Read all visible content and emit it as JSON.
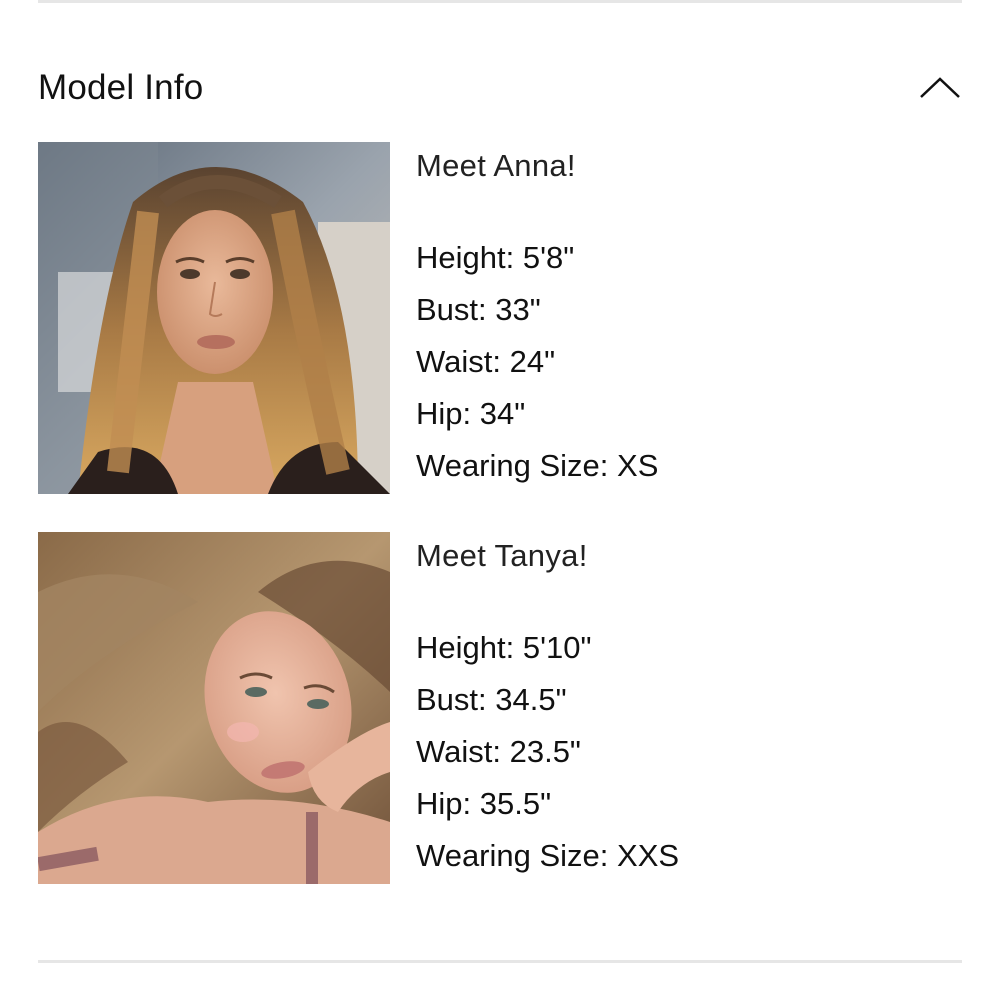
{
  "section": {
    "title": "Model Info",
    "icon": "chevron-up-icon"
  },
  "models": [
    {
      "greeting": "Meet Anna!",
      "photo_alt": "Anna",
      "stats": [
        {
          "label": "Height:",
          "value": "5'8\""
        },
        {
          "label": "Bust:",
          "value": "33\""
        },
        {
          "label": "Waist:",
          "value": "24\""
        },
        {
          "label": "Hip:",
          "value": "34\""
        },
        {
          "label": "Wearing Size:",
          "value": "XS"
        }
      ]
    },
    {
      "greeting": "Meet Tanya!",
      "photo_alt": "Tanya",
      "stats": [
        {
          "label": "Height:",
          "value": "5'10\""
        },
        {
          "label": "Bust:",
          "value": "34.5\""
        },
        {
          "label": "Waist:",
          "value": "23.5\""
        },
        {
          "label": "Hip:",
          "value": "35.5\""
        },
        {
          "label": "Wearing Size:",
          "value": "XXS"
        }
      ]
    }
  ],
  "colors": {
    "divider": "#e6e6e6",
    "text": "#111111"
  }
}
